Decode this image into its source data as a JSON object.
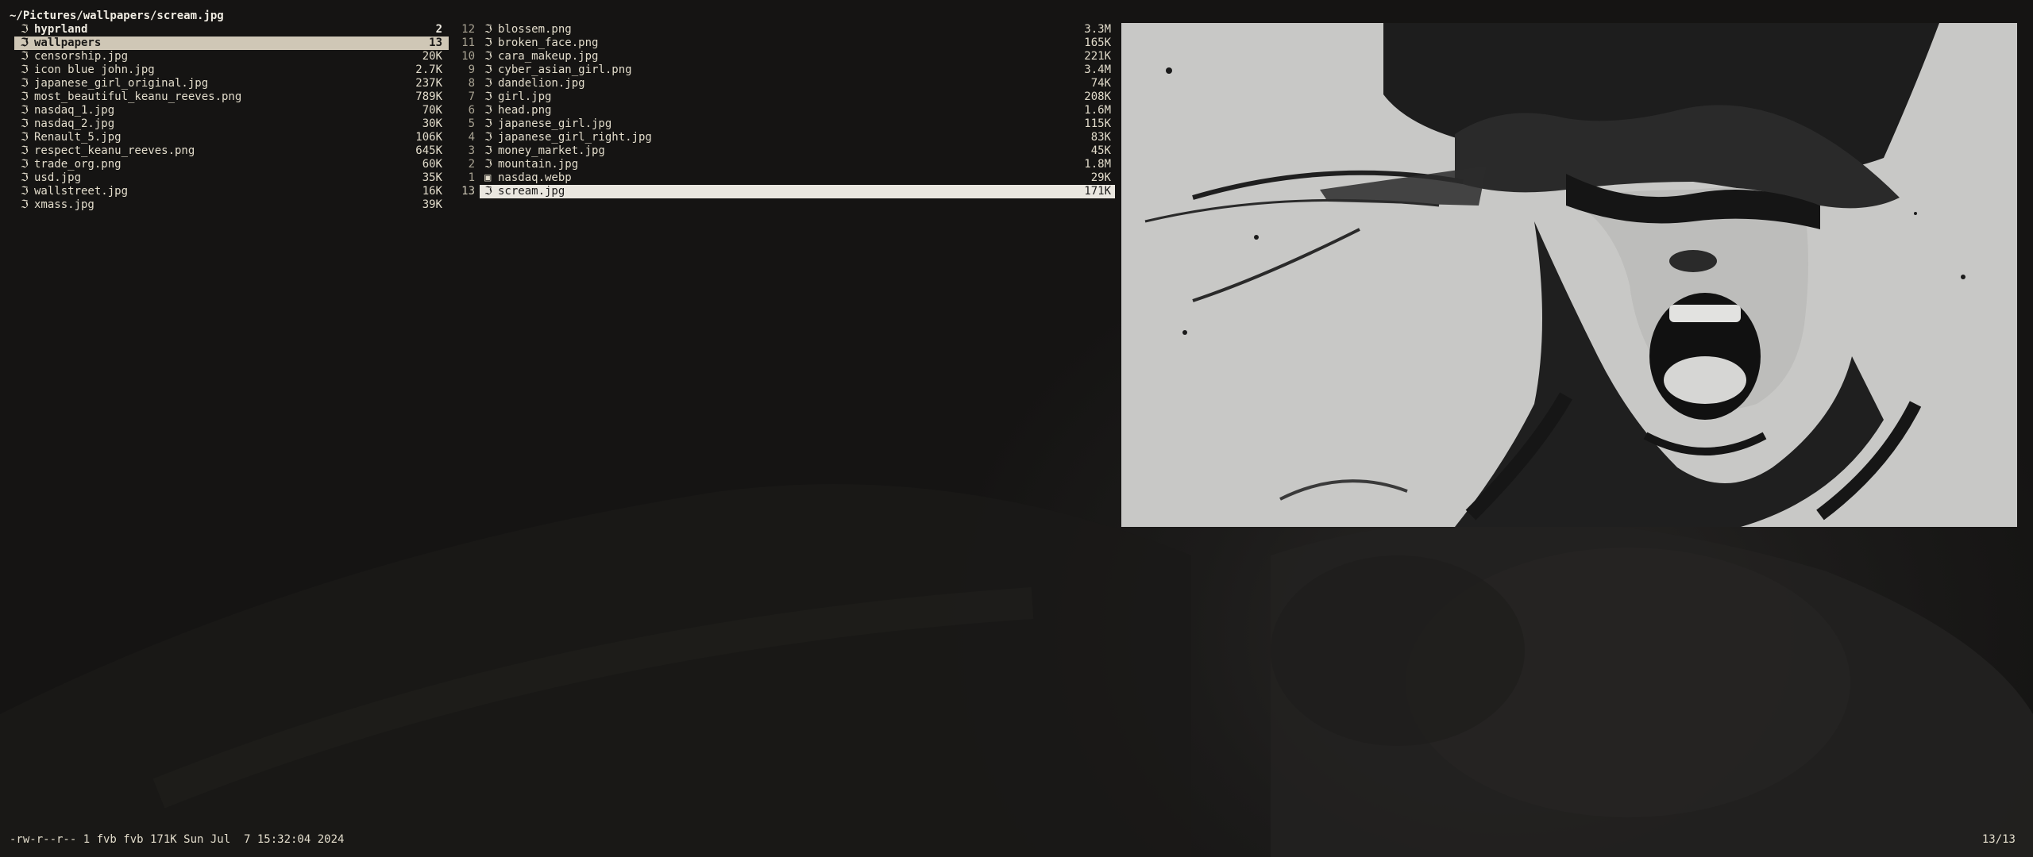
{
  "path": "~/Pictures/wallpapers/scream.jpg",
  "parent_entries": [
    {
      "name": "hyprland",
      "size": "2",
      "type": "dir",
      "icon": "folder-icon"
    },
    {
      "name": "wallpapers",
      "size": "13",
      "type": "dir",
      "icon": "folder-icon",
      "selected": true
    },
    {
      "name": "censorship.jpg",
      "size": "20K",
      "type": "file",
      "icon": "image-file-icon"
    },
    {
      "name": "icon blue john.jpg",
      "size": "2.7K",
      "type": "file",
      "icon": "image-file-icon"
    },
    {
      "name": "japanese_girl_original.jpg",
      "size": "237K",
      "type": "file",
      "icon": "image-file-icon"
    },
    {
      "name": "most_beautiful_keanu_reeves.png",
      "size": "789K",
      "type": "file",
      "icon": "image-file-icon"
    },
    {
      "name": "nasdaq_1.jpg",
      "size": "70K",
      "type": "file",
      "icon": "image-file-icon"
    },
    {
      "name": "nasdaq_2.jpg",
      "size": "30K",
      "type": "file",
      "icon": "image-file-icon"
    },
    {
      "name": "Renault_5.jpg",
      "size": "106K",
      "type": "file",
      "icon": "image-file-icon"
    },
    {
      "name": "respect_keanu_reeves.png",
      "size": "645K",
      "type": "file",
      "icon": "image-file-icon"
    },
    {
      "name": "trade_org.png",
      "size": "60K",
      "type": "file",
      "icon": "image-file-icon"
    },
    {
      "name": "usd.jpg",
      "size": "35K",
      "type": "file",
      "icon": "image-file-icon"
    },
    {
      "name": "wallstreet.jpg",
      "size": "16K",
      "type": "file",
      "icon": "image-file-icon"
    },
    {
      "name": "xmass.jpg",
      "size": "39K",
      "type": "file",
      "icon": "image-file-icon"
    }
  ],
  "current_entries": [
    {
      "lnum": "12",
      "name": "blossem.png",
      "size": "3.3M",
      "icon": "image-file-icon"
    },
    {
      "lnum": "11",
      "name": "broken_face.png",
      "size": "165K",
      "icon": "image-file-icon"
    },
    {
      "lnum": "10",
      "name": "cara_makeup.jpg",
      "size": "221K",
      "icon": "image-file-icon"
    },
    {
      "lnum": "9",
      "name": "cyber_asian_girl.png",
      "size": "3.4M",
      "icon": "image-file-icon"
    },
    {
      "lnum": "8",
      "name": "dandelion.jpg",
      "size": "74K",
      "icon": "image-file-icon"
    },
    {
      "lnum": "7",
      "name": "girl.jpg",
      "size": "208K",
      "icon": "image-file-icon"
    },
    {
      "lnum": "6",
      "name": "head.png",
      "size": "1.6M",
      "icon": "image-file-icon"
    },
    {
      "lnum": "5",
      "name": "japanese_girl.jpg",
      "size": "115K",
      "icon": "image-file-icon"
    },
    {
      "lnum": "4",
      "name": "japanese_girl_right.jpg",
      "size": "83K",
      "icon": "image-file-icon"
    },
    {
      "lnum": "3",
      "name": "money_market.jpg",
      "size": "45K",
      "icon": "image-file-icon"
    },
    {
      "lnum": "2",
      "name": "mountain.jpg",
      "size": "1.8M",
      "icon": "image-file-icon"
    },
    {
      "lnum": "1",
      "name": "nasdaq.webp",
      "size": "29K",
      "icon": "webp-file-icon"
    },
    {
      "lnum": "13",
      "name": "scream.jpg",
      "size": "171K",
      "icon": "image-file-icon",
      "cursor": true
    }
  ],
  "status": {
    "file_info": "-rw-r--r-- 1 fvb fvb 171K Sun Jul  7 15:32:04 2024",
    "position": "13/13"
  },
  "icons": {
    "image-file-icon": "ℑ",
    "folder-icon": "ℑ",
    "webp-file-icon": "▣"
  },
  "colors": {
    "background": "#151413",
    "text": "#e2dccb",
    "parent_selection": "#cfc7b6",
    "cursor_highlight": "#eae7e0"
  }
}
